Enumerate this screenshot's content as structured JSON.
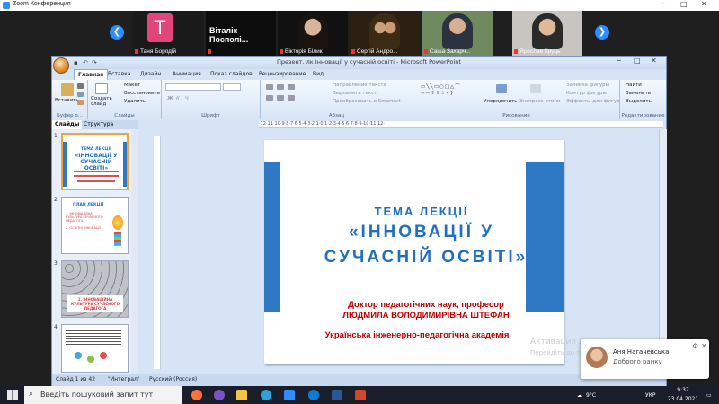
{
  "zoom": {
    "window_title": "Zoom Конференция",
    "participants": [
      {
        "name": "Таня Бородій",
        "initial": "T"
      },
      {
        "name": "Віталік Посполі..."
      },
      {
        "name": "Вікторія Білик"
      },
      {
        "name": "Сергій Андро..."
      },
      {
        "name": "Саша Захарч..."
      },
      {
        "name": "Ярослав Круць"
      }
    ]
  },
  "ppt": {
    "title": "Презент. лк Інновації у сучасній освіті - Microsoft PowerPoint",
    "tabs": [
      "Главная",
      "Вставка",
      "Дизайн",
      "Анимация",
      "Показ слайдов",
      "Рецензирование",
      "Вид"
    ],
    "ribbon": {
      "clipboard": {
        "paste": "Вставить",
        "label": "Буфер о..."
      },
      "slides": {
        "new": "Создать слайд",
        "layout": "Макет",
        "reset": "Восстановить",
        "delete": "Удалить",
        "label": "Слайды"
      },
      "font_label": "Шрифт",
      "paragraph": {
        "dir": "Направление текста",
        "align": "Выровнять текст",
        "smartart": "Преобразовать в SmartArt",
        "label": "Абзац"
      },
      "drawing": {
        "arrange": "Упорядочить",
        "styles": "Экспресс-стили",
        "fill": "Заливка фигуры",
        "outline": "Контур фигуры",
        "effects": "Эффекты для фигур",
        "label": "Рисование"
      },
      "editing": {
        "find": "Найти",
        "replace": "Заменить",
        "select": "Выделить",
        "label": "Редактирование"
      }
    },
    "left_tabs": [
      "Слайды",
      "Структура"
    ],
    "thumbs": [
      {
        "num": "1",
        "l1": "ТЕМА ЛЕКЦІЇ",
        "l2": "«ІННОВАЦІЇ У",
        "l3": "СУЧАСНІЙ ОСВІТІ»"
      },
      {
        "num": "2",
        "l1": "ПЛАН ЛЕКЦІЇ",
        "l2": "1. ІННОВАЦІЙНА КУЛЬТУРА СУЧАСНОГО ПЕДАГОГА",
        "l3": "2. ОСВІТНІ ІННОВАЦІЇ"
      },
      {
        "num": "3",
        "l1": "1. ІННОВАЦІЙНА КУЛЬТУРА СУЧАСНОГО ПЕДАГОГА"
      },
      {
        "num": "4"
      }
    ],
    "slide": {
      "topic": "ТЕМА ЛЕКЦІЇ",
      "title1": "«ІННОВАЦІЇ У",
      "title2": "СУЧАСНІЙ ОСВІТІ»",
      "author1": "Доктор педагогічних наук, професор",
      "author2": "ЛЮДМИЛА  ВОЛОДИМИРІВНА  ШТЕФАН",
      "org": "Українська інженерно-педагогічна  академія"
    },
    "status": {
      "slide": "Слайд 1 из 42",
      "theme": "\"Интеграл\"",
      "lang": "Русский (Россия)"
    }
  },
  "toast": {
    "name": "Аня Нагачевська",
    "message": "Доброго ранку"
  },
  "watermark": {
    "line1": "Активация Windows",
    "line2": "Перейдіть до параметрів"
  },
  "taskbar": {
    "search": "Введіть пошуковий запит тут",
    "weather": "9°C",
    "lang": "УКР",
    "time": "9:37",
    "date": "23.04.2021"
  },
  "colors": {
    "accent_blue": "#2f78c4",
    "title_blue": "#1f6fc3",
    "red_text": "#c00000",
    "zoom_blue": "#2d8cff"
  }
}
